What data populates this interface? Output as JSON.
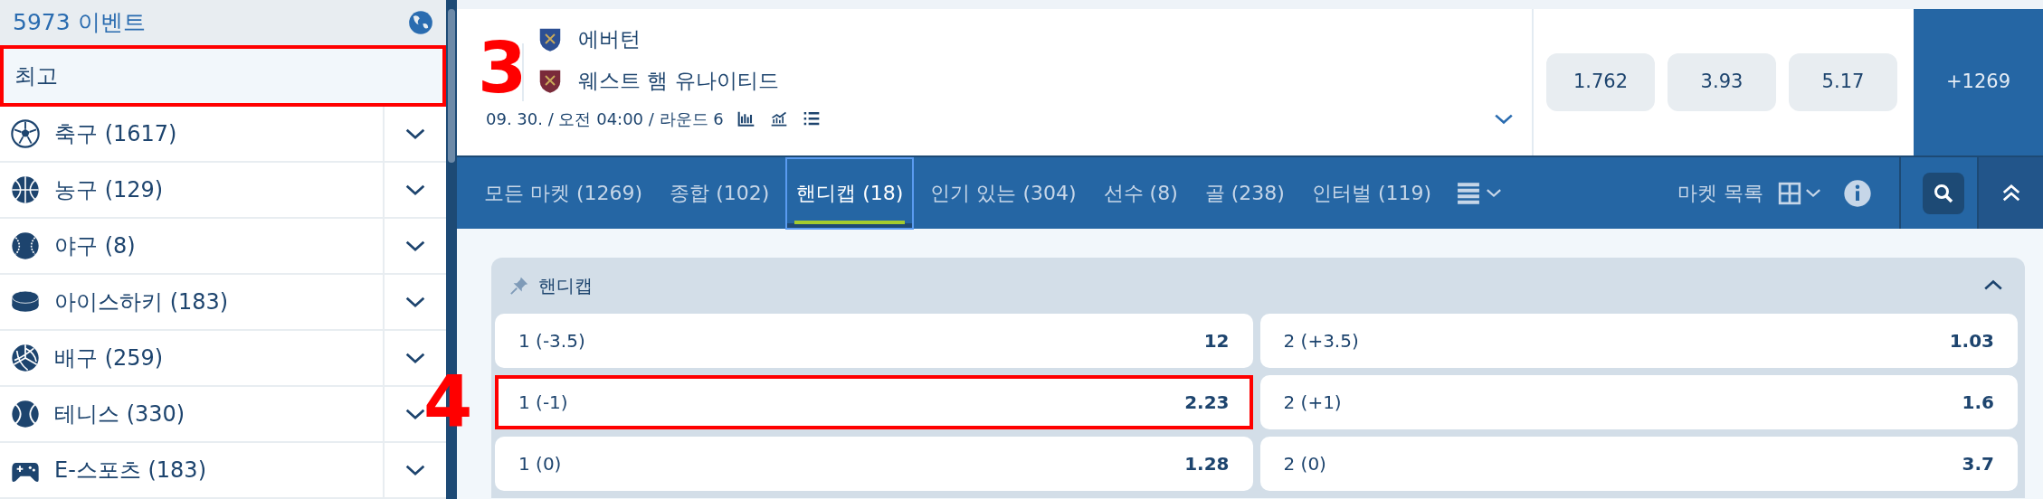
{
  "sidebar": {
    "title": "5973 이벤트",
    "top_item": {
      "label": "최고",
      "annotated": true
    },
    "sports": [
      {
        "label": "축구 (1617)",
        "kind": "soccer"
      },
      {
        "label": "농구 (129)",
        "kind": "basketball"
      },
      {
        "label": "야구 (8)",
        "kind": "baseball"
      },
      {
        "label": "아이스하키 (183)",
        "kind": "hockey"
      },
      {
        "label": "배구 (259)",
        "kind": "volleyball"
      },
      {
        "label": "테니스 (330)",
        "kind": "tennis"
      },
      {
        "label": "E-스포츠 (183)",
        "kind": "esports"
      }
    ]
  },
  "match": {
    "teams": [
      {
        "name": "에버턴",
        "kind": "blue-crest"
      },
      {
        "name": "웨스트 햄 유나이티드",
        "kind": "claret-crest"
      }
    ],
    "info": "09. 30. / 오전 04:00 / 라운드 6",
    "odds": [
      "1.762",
      "3.93",
      "5.17"
    ],
    "more": "+1269"
  },
  "market_tabs": [
    {
      "label": "모든 마켓 (1269)",
      "selected": false
    },
    {
      "label": "종합 (102)",
      "selected": false
    },
    {
      "label": "핸디캡 (18)",
      "selected": true
    },
    {
      "label": "인기 있는 (304)",
      "selected": false
    },
    {
      "label": "선수 (8)",
      "selected": false
    },
    {
      "label": "골 (238)",
      "selected": false
    },
    {
      "label": "인터벌 (119)",
      "selected": false
    }
  ],
  "market_list_label": "마켓 목록",
  "market_group": {
    "title": "핸디캡",
    "expanded": true,
    "rows": [
      [
        {
          "label": "1 (-3.5)",
          "odd": "12",
          "annotated": false
        },
        {
          "label": "2 (+3.5)",
          "odd": "1.03",
          "annotated": false
        }
      ],
      [
        {
          "label": "1 (-1)",
          "odd": "2.23",
          "annotated": true
        },
        {
          "label": "2 (+1)",
          "odd": "1.6",
          "annotated": false
        }
      ],
      [
        {
          "label": "1 (0)",
          "odd": "1.28",
          "annotated": false
        },
        {
          "label": "2 (0)",
          "odd": "3.7",
          "annotated": false
        }
      ]
    ]
  },
  "annotations": [
    {
      "text": "3"
    },
    {
      "text": "4"
    }
  ]
}
